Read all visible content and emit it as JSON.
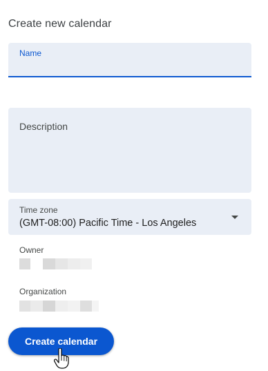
{
  "page": {
    "title": "Create new calendar"
  },
  "form": {
    "name": {
      "label": "Name",
      "value": ""
    },
    "description": {
      "label": "Description",
      "value": ""
    },
    "timezone": {
      "label": "Time zone",
      "value": "(GMT-08:00) Pacific Time - Los Angeles"
    },
    "owner": {
      "label": "Owner"
    },
    "organization": {
      "label": "Organization"
    }
  },
  "actions": {
    "create_label": "Create calendar"
  },
  "icons": {
    "dropdown": "caret-down-icon",
    "cursor": "hand-pointer-icon"
  },
  "colors": {
    "accent": "#0b57d0",
    "field_background": "#e9eef6",
    "redacted_light": "#ececec",
    "redacted_dark": "#d9d9d9"
  }
}
